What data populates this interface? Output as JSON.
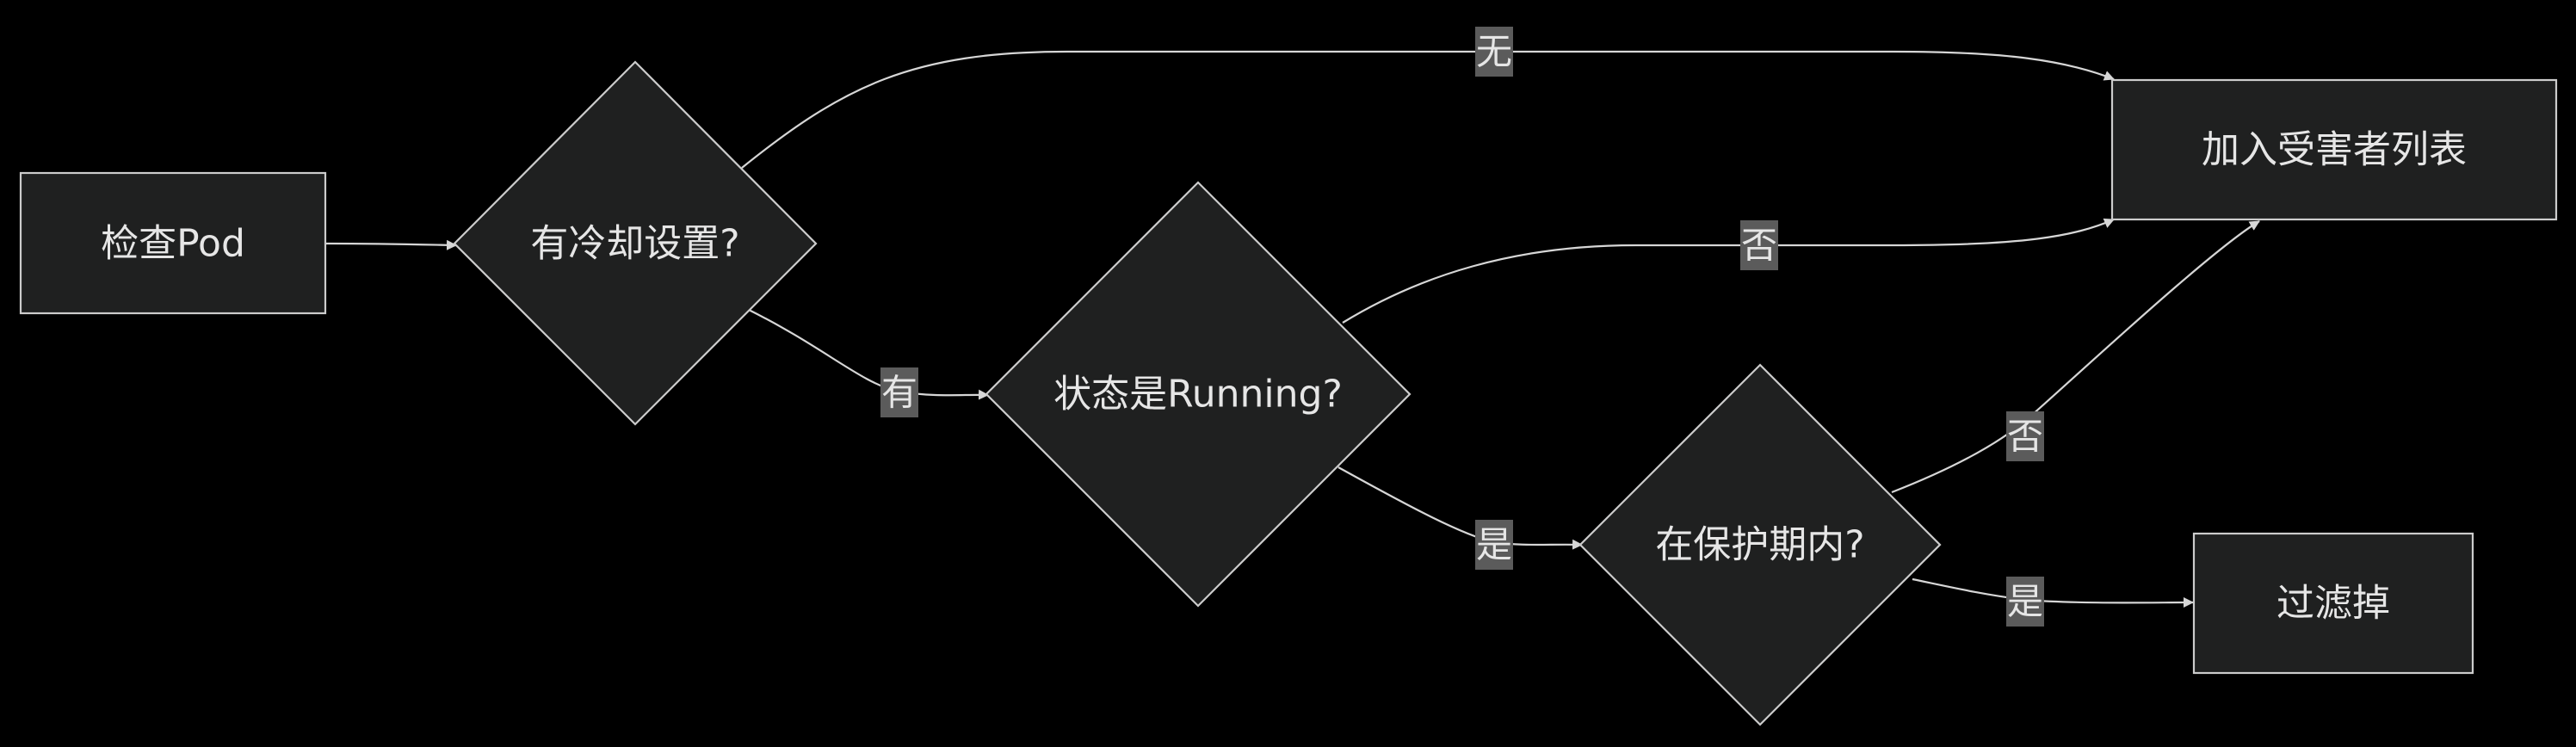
{
  "diagram": {
    "type": "flowchart",
    "colors": {
      "background": "#000000",
      "node_fill": "#1f2020",
      "node_stroke": "#cccccc",
      "edge": "#d6d6d6",
      "label_bg": "#5b5b5b",
      "text": "#e6e6e6"
    },
    "nodes": {
      "check_pod": "检查Pod",
      "has_cooldown": "有冷却设置?",
      "is_running": "状态是Running?",
      "in_protection": "在保护期内?",
      "add_victim": "加入受害者列表",
      "filter_out": "过滤掉"
    },
    "edges": {
      "none": "无",
      "has": "有",
      "no_running": "否",
      "yes_running": "是",
      "no_protect": "否",
      "yes_protect": "是"
    }
  }
}
